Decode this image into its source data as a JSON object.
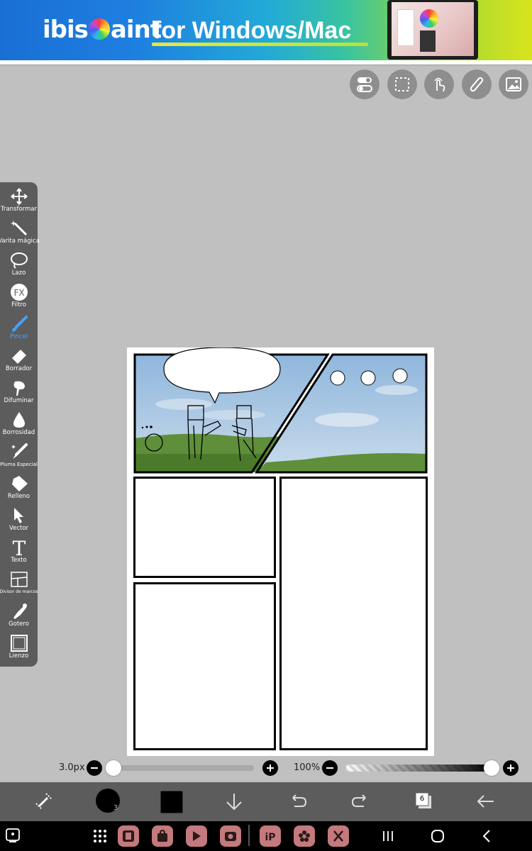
{
  "banner": {
    "brand_prefix": "ibis",
    "brand_suffix": "aint",
    "tagline": "for Windows/Mac"
  },
  "toolbar": {
    "items": [
      {
        "label": "Transformar",
        "icon": "move-arrows-icon"
      },
      {
        "label": "Varita mágica",
        "icon": "magic-wand-icon"
      },
      {
        "label": "Lazo",
        "icon": "lasso-icon"
      },
      {
        "label": "Filtro",
        "icon": "fx-icon"
      },
      {
        "label": "Pincel",
        "icon": "brush-icon",
        "active": true
      },
      {
        "label": "Borrador",
        "icon": "eraser-icon"
      },
      {
        "label": "Difuminar",
        "icon": "smudge-icon"
      },
      {
        "label": "Borrosidad",
        "icon": "blur-drop-icon"
      },
      {
        "label": "Pluma Especial",
        "icon": "special-pen-icon"
      },
      {
        "label": "Relleno",
        "icon": "fill-icon"
      },
      {
        "label": "Vector",
        "icon": "vector-cursor-icon"
      },
      {
        "label": "Texto",
        "icon": "text-icon"
      },
      {
        "label": "Divisor de marcos",
        "icon": "frame-divider-icon"
      },
      {
        "label": "Gotero",
        "icon": "eyedropper-icon"
      },
      {
        "label": "Lienzo",
        "icon": "canvas-icon"
      }
    ]
  },
  "sliders": {
    "brush_size": "3.0px",
    "brush_size_level": 0.0,
    "opacity": "100%",
    "opacity_level": 1.0
  },
  "bottombar": {
    "layer_count": "6"
  },
  "colors": {
    "active_tool": "#4aa0ff",
    "toolbar_bg": "#5c5c5c",
    "app_icon_bg": "#c4797c"
  }
}
